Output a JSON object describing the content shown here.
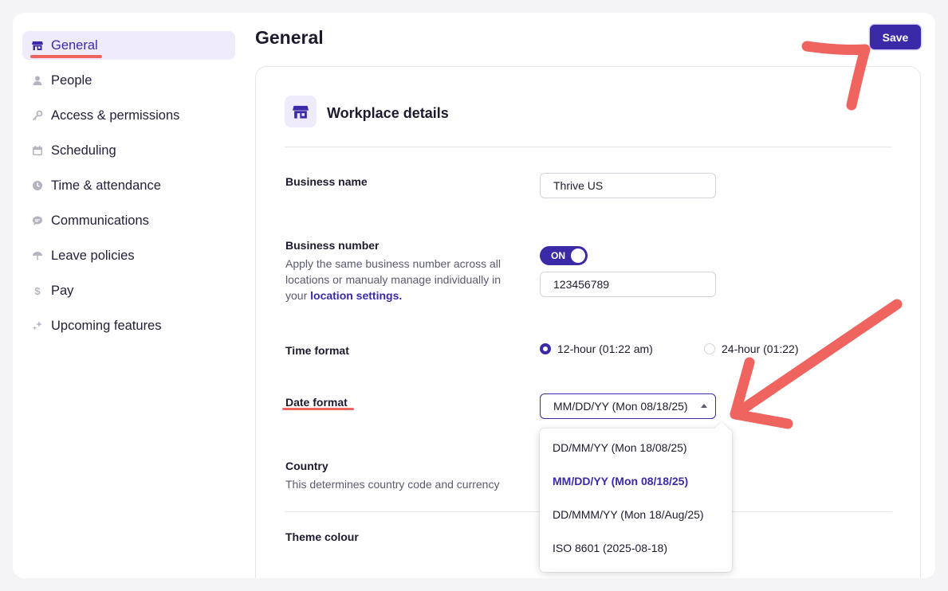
{
  "sidebar": {
    "items": [
      {
        "label": "General",
        "icon": "store-icon",
        "active": true
      },
      {
        "label": "People",
        "icon": "person-icon"
      },
      {
        "label": "Access & permissions",
        "icon": "key-icon"
      },
      {
        "label": "Scheduling",
        "icon": "calendar-icon"
      },
      {
        "label": "Time & attendance",
        "icon": "clock-icon"
      },
      {
        "label": "Communications",
        "icon": "chat-icon"
      },
      {
        "label": "Leave policies",
        "icon": "umbrella-icon"
      },
      {
        "label": "Pay",
        "icon": "dollar-icon"
      },
      {
        "label": "Upcoming features",
        "icon": "sparkle-icon"
      }
    ]
  },
  "header": {
    "title": "General",
    "save_label": "Save"
  },
  "card": {
    "title": "Workplace details",
    "business_name": {
      "label": "Business name",
      "value": "Thrive US"
    },
    "business_number": {
      "label": "Business number",
      "desc_line1": "Apply the same business number across all",
      "desc_line2": "locations or manualy manage individually in",
      "desc_prefix": "your ",
      "desc_link": "location settings.",
      "toggle_label": "ON",
      "toggle_on": true,
      "value": "123456789"
    },
    "time_format": {
      "label": "Time format",
      "options": [
        "12-hour (01:22 am)",
        "24-hour (01:22)"
      ],
      "selected": "12-hour (01:22 am)"
    },
    "date_format": {
      "label": "Date format",
      "value": "MM/DD/YY (Mon 08/18/25)",
      "options": [
        "DD/MM/YY (Mon 18/08/25)",
        "MM/DD/YY (Mon 08/18/25)",
        "DD/MMM/YY (Mon 18/Aug/25)",
        "ISO 8601 (2025-08-18)"
      ]
    },
    "country": {
      "label": "Country",
      "desc": "This determines country code and currency"
    },
    "theme": {
      "label": "Theme colour"
    }
  },
  "colors": {
    "accent": "#3b2aa8",
    "annotation": "#f0645f",
    "accent_light": "#efebfb"
  }
}
